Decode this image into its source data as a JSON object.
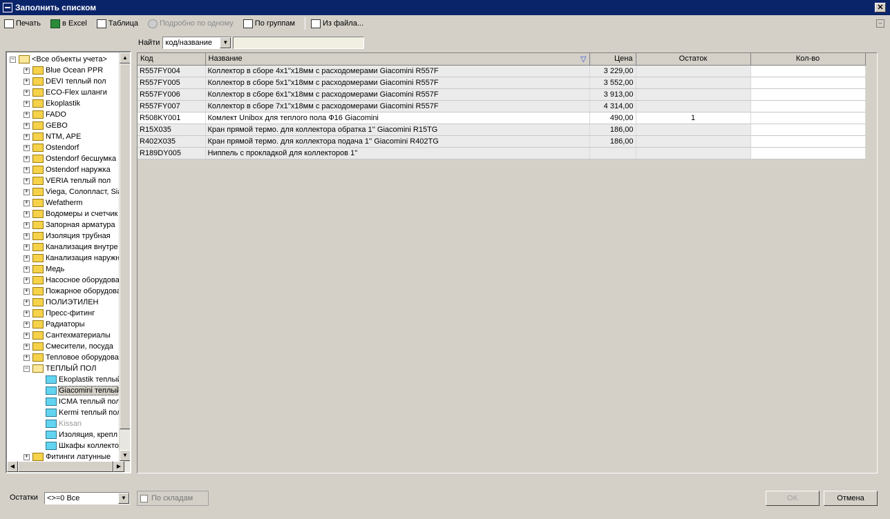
{
  "window": {
    "title": "Заполнить списком",
    "close": "✕"
  },
  "toolbar": {
    "print": "Печать",
    "excel": "в Excel",
    "table": "Таблица",
    "one_by_one": "Подробно по одному",
    "by_groups": "По группам",
    "from_file": "Из файла..."
  },
  "search": {
    "label": "Найти",
    "mode": "код/название",
    "value": ""
  },
  "tree": {
    "root": "<Все объекты учета>",
    "items": [
      "Blue Ocean PPR",
      "DEVI теплый пол",
      "ECO-Flex шланги",
      "Ekoplastik",
      "FADO",
      "GEBO",
      "NTM, APE",
      "Ostendorf",
      "Ostendorf бесшумка",
      "Ostendorf наружка",
      "VERIA теплый пол",
      "Viega, Солопласт, Sia",
      "Wefatherm",
      "Водомеры и счетчик",
      "Запорная арматура",
      "Изоляция трубная",
      "Канализация внутре",
      "Канализация наружн",
      "Медь",
      "Насосное оборудова",
      "Пожарное оборудова",
      "ПОЛИЭТИЛЕН",
      "Пресс-фитинг",
      "Радиаторы",
      "Сантехматериалы",
      "Смесители, посуда",
      "Тепловое оборудова",
      "ТЕПЛЫЙ ПОЛ"
    ],
    "children": [
      "Ekoplastik теплый",
      "Giacomini теплый",
      "ICMA теплый пол",
      "Kermi теплый пол",
      "Kissan",
      "Изоляция, крепл",
      "Шкафы коллекто"
    ],
    "last": "Фитинги латунные"
  },
  "grid": {
    "headers": {
      "code": "Код",
      "name": "Название",
      "price": "Цена",
      "stock": "Остаток",
      "qty": "Кол-во"
    },
    "rows": [
      {
        "code": "R557FY004",
        "name": "Коллектор в сборе 4x1''x18мм с расходомерами Giacomini R557F",
        "price": "3 229,00",
        "stock": "",
        "qty": ""
      },
      {
        "code": "R557FY005",
        "name": "Коллектор в сборе 5x1''x18мм с расходомерами Giacomini R557F",
        "price": "3 552,00",
        "stock": "",
        "qty": ""
      },
      {
        "code": "R557FY006",
        "name": "Коллектор в сборе 6x1''x18мм с расходомерами Giacomini R557F",
        "price": "3 913,00",
        "stock": "",
        "qty": ""
      },
      {
        "code": "R557FY007",
        "name": "Коллектор в сборе 7x1''x18мм с расходомерами Giacomini R557F",
        "price": "4 314,00",
        "stock": "",
        "qty": ""
      },
      {
        "code": "R508KY001",
        "name": "Комлект Unibox для теплого пола Ф16 Giacomini",
        "price": "490,00",
        "stock": "1",
        "qty": ""
      },
      {
        "code": "R15X035",
        "name": "Кран прямой термо. для коллектора обратка 1'' Giacomini R15TG",
        "price": "186,00",
        "stock": "",
        "qty": ""
      },
      {
        "code": "R402X035",
        "name": "Кран прямой термо. для коллектора подача 1'' Giacomini R402TG",
        "price": "186,00",
        "stock": "",
        "qty": ""
      },
      {
        "code": "R189DY005",
        "name": "Ниппель с прокладкой для коллекторов 1''",
        "price": "",
        "stock": "",
        "qty": ""
      }
    ]
  },
  "footer": {
    "stock_label": "Остатки",
    "stock_filter": "<>=0 Все",
    "by_warehouses": "По складам",
    "ok": "OK",
    "cancel": "Отмена"
  }
}
